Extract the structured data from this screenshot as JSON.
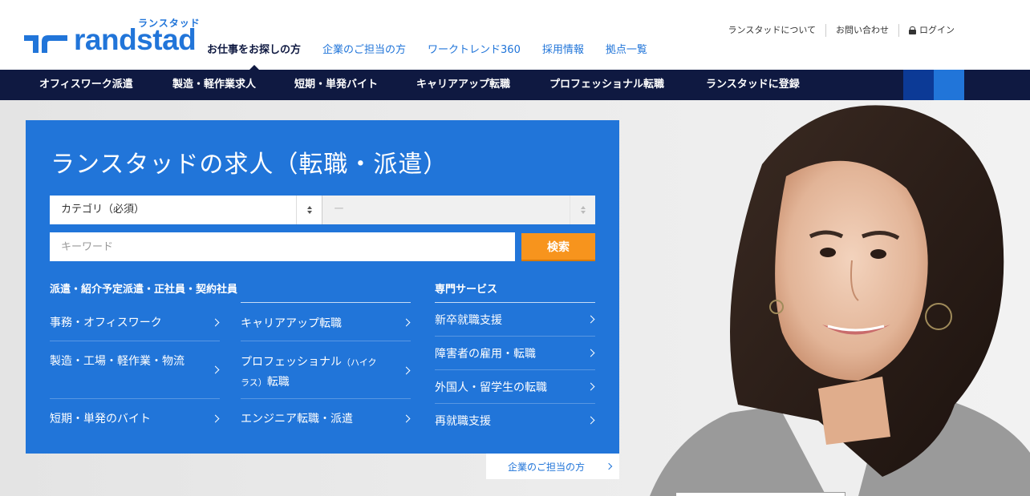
{
  "header": {
    "logo_kana": "ランスタッド",
    "logo_word": "randstad",
    "main_nav": [
      "お仕事をお探しの方",
      "企業のご担当の方",
      "ワークトレンド360",
      "採用情報",
      "拠点一覧"
    ],
    "util_nav": {
      "about": "ランスタッドについて",
      "contact": "お問い合わせ",
      "login": "ログイン"
    }
  },
  "category_bar": [
    "オフィスワーク派遣",
    "製造・軽作業求人",
    "短期・単発バイト",
    "キャリアアップ転職",
    "プロフェッショナル転職",
    "ランスタッドに登録"
  ],
  "search": {
    "title": "ランスタッドの求人（転職・派遣）",
    "category_select": "カテゴリ（必須）",
    "sub_select": "ー",
    "keyword_placeholder": "キーワード",
    "button": "検索"
  },
  "left_section": {
    "heading": "派遣・紹介予定派遣・正社員・契約社員",
    "col1": [
      "事務・オフィスワーク",
      "製造・工場・軽作業・物流",
      "短期・単発のバイト"
    ],
    "col2": {
      "career": "キャリアアップ転職",
      "pro_a": "プロフェッショナル",
      "pro_b": "（ハイク",
      "pro_c": "ラス）",
      "pro_d": "転職",
      "engineer": "エンジニア転職・派遣"
    }
  },
  "right_section": {
    "heading": "専門サービス",
    "items": [
      "新卒就職支援",
      "障害者の雇用・転職",
      "外国人・留学生の転職",
      "再就職支援"
    ]
  },
  "corporate_tab": "企業のご担当の方",
  "colors": {
    "brand_blue": "#2175d9",
    "navy": "#0f1941",
    "orange": "#f7941d"
  }
}
